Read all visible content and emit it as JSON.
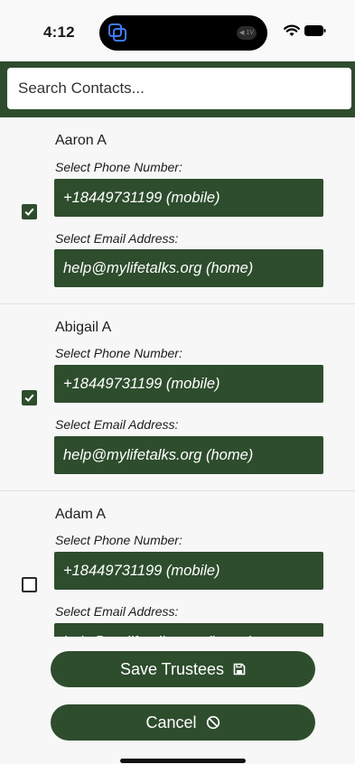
{
  "status_bar": {
    "time": "4:12",
    "island_badge": "◀ 1V"
  },
  "search": {
    "placeholder": "Search Contacts..."
  },
  "contacts": [
    {
      "name": "Aaron A",
      "phone_label": "Select Phone Number:",
      "phone": "+18449731199 (mobile)",
      "email_label": "Select Email Address:",
      "email": "help@mylifetalks.org (home)",
      "checked": true
    },
    {
      "name": "Abigail A",
      "phone_label": "Select Phone Number:",
      "phone": "+18449731199 (mobile)",
      "email_label": "Select Email Address:",
      "email": "help@mylifetalks.org (home)",
      "checked": true
    },
    {
      "name": "Adam A",
      "phone_label": "Select Phone Number:",
      "phone": "+18449731199 (mobile)",
      "email_label": "Select Email Address:",
      "email": "help@mylifetalks.org (home)",
      "checked": false
    }
  ],
  "buttons": {
    "save_label": "Save Trustees",
    "save_icon": "save-icon",
    "cancel_label": "Cancel",
    "cancel_icon": "cancel-icon"
  },
  "colors": {
    "primary": "#2e4d2d",
    "background": "#f7f7f7"
  }
}
